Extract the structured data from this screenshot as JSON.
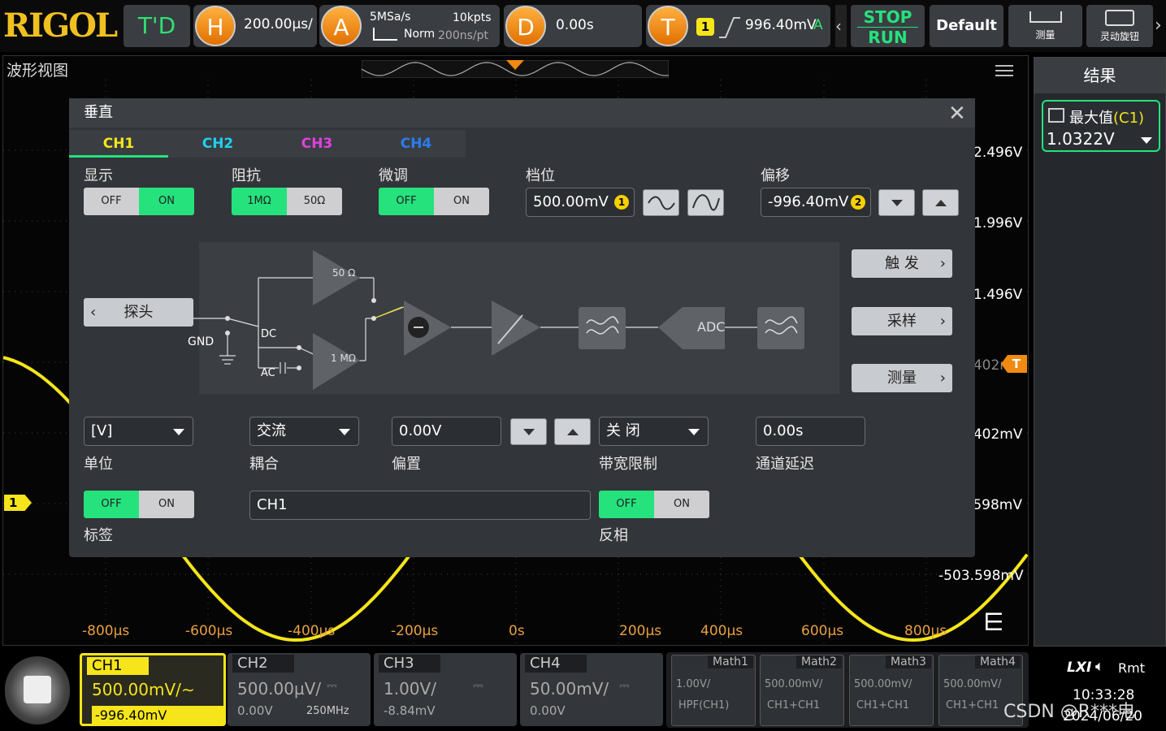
{
  "brand": "RIGOL",
  "topbar": {
    "td": "T'D",
    "h_label": "H",
    "h_value": "200.00µs/",
    "a_label": "A",
    "sample_rate": "5MSa/s",
    "mem_depth": "10kpts",
    "acq_mode": "Norm",
    "time_per_pt": "200ns/pt",
    "d_label": "D",
    "delay": "0.00s",
    "t_label": "T",
    "trig_ch": "1",
    "trig_level": "996.40mV",
    "trig_mode": "A",
    "stop": "STOP",
    "run": "RUN",
    "default": "Default",
    "measure": "测量",
    "knob": "灵动旋钮"
  },
  "wave": {
    "title": "波形视图",
    "y_labels": [
      "2.496V",
      "1.996V",
      "1.496V",
      "996.402mV",
      "496.402mV",
      "-3.598mV",
      "-503.598mV"
    ],
    "x_labels": [
      "-800µs",
      "-600µs",
      "-400µs",
      "-200µs",
      "0s",
      "200µs",
      "400µs",
      "600µs",
      "800µs"
    ],
    "ch_marker": "1",
    "trig_marker": "T"
  },
  "dialog": {
    "title": "垂直",
    "tabs": [
      "CH1",
      "CH2",
      "CH3",
      "CH4"
    ],
    "display_label": "显示",
    "display_off": "OFF",
    "display_on": "ON",
    "impedance_label": "阻抗",
    "imp_1m": "1MΩ",
    "imp_50": "50Ω",
    "fine_label": "微调",
    "fine_off": "OFF",
    "fine_on": "ON",
    "scale_label": "档位",
    "scale_value": "500.00mV",
    "scale_badge": "1",
    "offset_label": "偏移",
    "offset_value": "-996.40mV",
    "offset_badge": "2",
    "probe_btn": "探头",
    "diagram": {
      "gnd": "GND",
      "dc": "DC",
      "ac": "AC",
      "r50": "50 Ω",
      "r1m": "1 MΩ",
      "adc": "ADC"
    },
    "side_btns": [
      "触 发",
      "采样",
      "测量"
    ],
    "unit_value": "[V]",
    "unit_label": "单位",
    "coupling_value": "交流",
    "coupling_label": "耦合",
    "bias_value": "0.00V",
    "bias_label": "偏置",
    "bw_value": "关 闭",
    "bw_label": "带宽限制",
    "delay_value": "0.00s",
    "delay_label": "通道延迟",
    "tag_label": "标签",
    "tag_off": "OFF",
    "tag_on": "ON",
    "tag_value": "CH1",
    "invert_label": "反相",
    "invert_off": "OFF",
    "invert_on": "ON"
  },
  "results": {
    "title": "结果",
    "item_label": "最大值",
    "item_ch": "(C1)",
    "item_value": "1.0322V"
  },
  "channels": [
    {
      "name": "CH1",
      "scale": "500.00mV/",
      "offset": "-996.40mV",
      "extra": ""
    },
    {
      "name": "CH2",
      "scale": "500.00µV/",
      "offset": "0.00V",
      "extra": "250MHz"
    },
    {
      "name": "CH3",
      "scale": "1.00V/",
      "offset": "-8.84mV",
      "extra": ""
    },
    {
      "name": "CH4",
      "scale": "50.00mV/",
      "offset": "0.00V",
      "extra": ""
    }
  ],
  "maths": [
    {
      "name": "Math1",
      "line1": "1.00V/",
      "line2": "HPF(CH1)"
    },
    {
      "name": "Math2",
      "line1": "500.00mV/",
      "line2": "CH1+CH1"
    },
    {
      "name": "Math3",
      "line1": "500.00mV/",
      "line2": "CH1+CH1"
    },
    {
      "name": "Math4",
      "line1": "500.00mV/",
      "line2": "CH1+CH1"
    }
  ],
  "status": {
    "lxi": "LXI",
    "rmt": "Rmt",
    "time": "10:33:28",
    "date": "2024/06/20",
    "watermark": "CSDN @R***电"
  },
  "colors": {
    "ch1": "#f5e51a",
    "ch2": "#1fd0f0",
    "ch3": "#e040e0",
    "ch4": "#2a7cf0",
    "accent_green": "#25e27d",
    "orange": "#f08a10"
  }
}
